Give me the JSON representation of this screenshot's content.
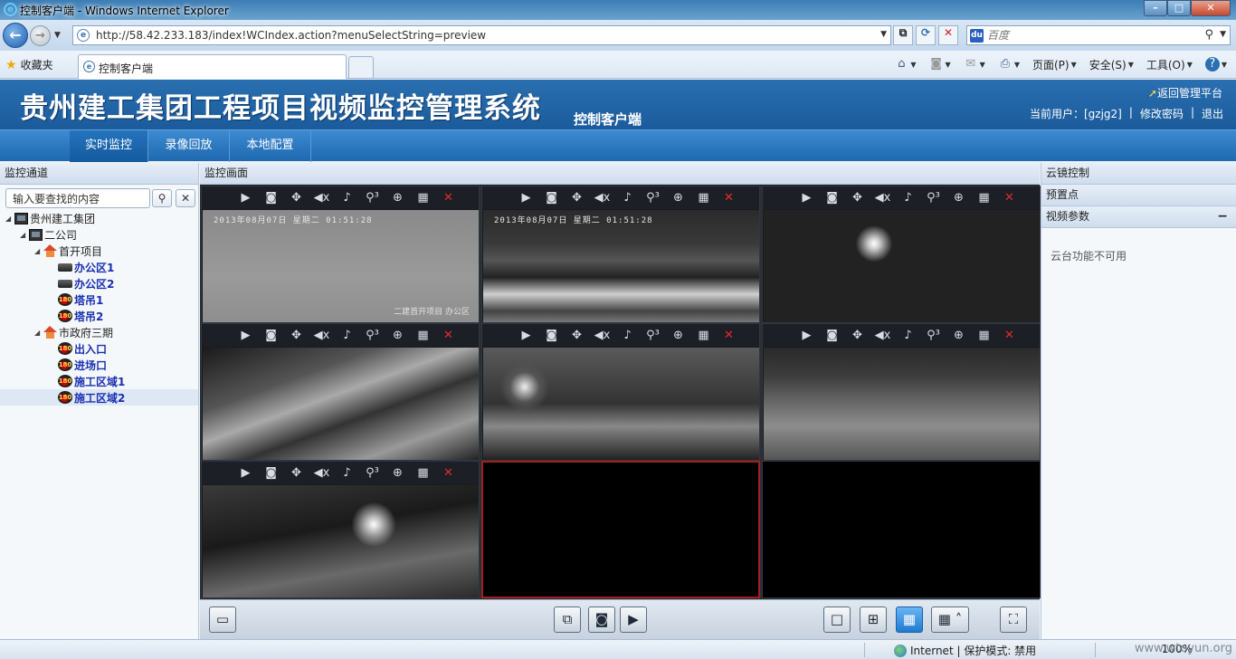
{
  "window": {
    "title": "控制客户端 - Windows Internet Explorer",
    "url": "http://58.42.233.183/index!WCIndex.action?menuSelectString=preview",
    "search_placeholder": "百度",
    "favorites_label": "收藏夹",
    "tab_label": "控制客户端",
    "commands": [
      "页面(P)",
      "安全(S)",
      "工具(O)"
    ]
  },
  "header": {
    "system_title": "贵州建工集团工程项目视频监控管理系统",
    "subtitle": "控制客户端",
    "back_link": "返回管理平台",
    "current_user_label": "当前用户：[gzjg2]",
    "change_password": "修改密码",
    "logout": "退出"
  },
  "nav": {
    "tabs": [
      "实时监控",
      "录像回放",
      "本地配置"
    ],
    "active_tab": "实时监控"
  },
  "left_panel": {
    "title": "监控通道",
    "search_value": "输入要查找的内容",
    "tree": [
      {
        "label": "贵州建工集团",
        "level": 0,
        "icon": "pc-icon"
      },
      {
        "label": "二公司",
        "level": 1,
        "icon": "pc-icon"
      },
      {
        "label": "首开项目",
        "level": 2,
        "icon": "house-icon"
      },
      {
        "label": "办公区1",
        "level": 3,
        "icon": "camera-icon",
        "camera": true
      },
      {
        "label": "办公区2",
        "level": 3,
        "icon": "camera-icon",
        "camera": true
      },
      {
        "label": "塔吊1",
        "level": 3,
        "icon": "dome-camera-icon",
        "camera": true
      },
      {
        "label": "塔吊2",
        "level": 3,
        "icon": "dome-camera-icon",
        "camera": true
      },
      {
        "label": "市政府三期",
        "level": 2,
        "icon": "house-icon"
      },
      {
        "label": "出入口",
        "level": 3,
        "icon": "dome-camera-icon",
        "camera": true
      },
      {
        "label": "进场口",
        "level": 3,
        "icon": "dome-camera-icon",
        "camera": true
      },
      {
        "label": "施工区域1",
        "level": 3,
        "icon": "dome-camera-icon",
        "camera": true
      },
      {
        "label": "施工区域2",
        "level": 3,
        "icon": "dome-camera-icon",
        "camera": true,
        "selected": true
      }
    ]
  },
  "center_panel": {
    "title": "监控画面",
    "cell_tools": [
      "record-icon",
      "snapshot-icon",
      "ptz-icon",
      "mute-icon",
      "mic-icon",
      "zoom-3d-icon",
      "zoom-in-icon",
      "stream-icon",
      "close-icon"
    ],
    "feeds": [
      {
        "stamp": "2013年08月07日  星期二  01:51:28",
        "caption": "二建首开项目 办公区",
        "active": true
      },
      {
        "stamp": "2013年08月07日  星期二  01:51:28",
        "caption": "",
        "active": true
      },
      {
        "stamp": "",
        "caption": "",
        "active": true
      },
      {
        "stamp": "",
        "caption": "",
        "active": true
      },
      {
        "stamp": "",
        "caption": "",
        "active": true
      },
      {
        "stamp": "",
        "caption": "",
        "active": true
      },
      {
        "stamp": "",
        "caption": "",
        "active": true
      },
      {
        "stamp": "",
        "caption": "",
        "active": false,
        "selected": true
      },
      {
        "stamp": "",
        "caption": "",
        "active": false
      }
    ]
  },
  "right_panel": {
    "sections": [
      "云镜控制",
      "预置点",
      "视频参数"
    ],
    "ptz_message": "云台功能不可用"
  },
  "statusbar": {
    "zone": "Internet | 保护模式: 禁用",
    "zoom": "100%",
    "watermark": "www.wtoyun.org"
  }
}
